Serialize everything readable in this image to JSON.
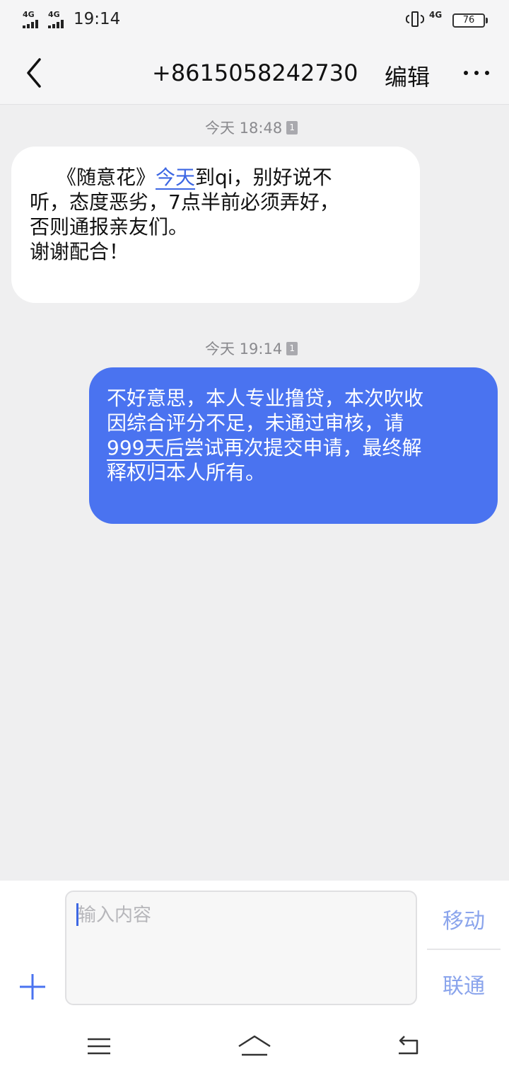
{
  "status_bar": {
    "signal_1": "4G",
    "signal_2": "4G",
    "time": "19:14",
    "network": "4G",
    "battery": "76"
  },
  "header": {
    "title": "+8615058242730",
    "edit_label": "编辑"
  },
  "messages": [
    {
      "timestamp": "今天 18:48",
      "sim": "1",
      "direction": "incoming",
      "lines": [
        {
          "pre": "《随意花》",
          "link": "今天",
          "post": "到qi，别好说不"
        },
        {
          "text": "听，态度恶劣，7点半前必须弄好，"
        },
        {
          "text": "否则通报亲友们。"
        },
        {
          "text": "谢谢配合！"
        }
      ]
    },
    {
      "timestamp": "今天 19:14",
      "sim": "1",
      "direction": "outgoing",
      "lines": [
        {
          "text": "不好意思，本人专业撸贷，本次吹收"
        },
        {
          "text": "因综合评分不足，未通过审核，请"
        },
        {
          "link": "999天后",
          "post": "尝试再次提交申请，最终解"
        },
        {
          "text": "释权归本人所有。"
        }
      ]
    }
  ],
  "compose": {
    "placeholder": "输入内容",
    "send_sim_1": "移动",
    "send_sim_2": "联通"
  },
  "colors": {
    "accent": "#4a73f0",
    "background": "#efeff0",
    "incoming_bubble": "#ffffff"
  },
  "icons": [
    "back-arrow-icon",
    "more-icon",
    "plus-icon",
    "menu-icon",
    "home-icon",
    "return-icon"
  ]
}
